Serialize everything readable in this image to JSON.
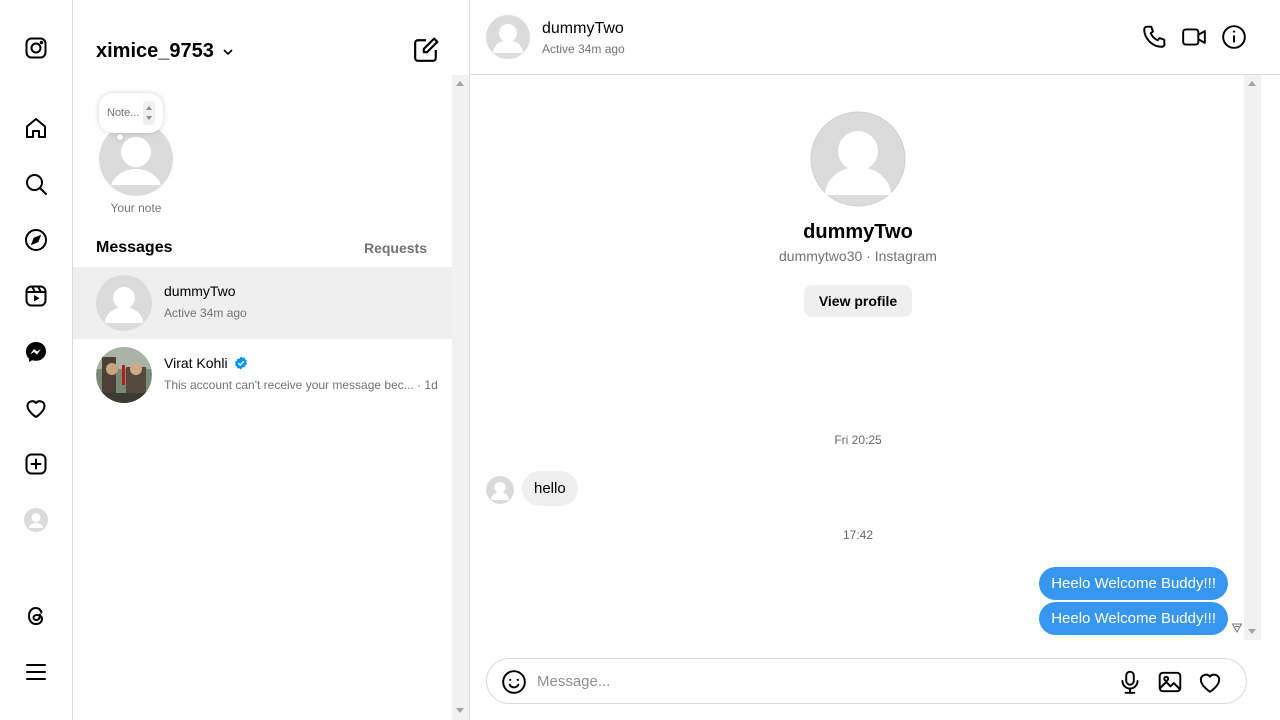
{
  "sidebar": {
    "icons": [
      "instagram-icon",
      "home-icon",
      "search-icon",
      "explore-icon",
      "reels-icon",
      "messenger-icon",
      "notifications-icon",
      "create-icon",
      "profile-avatar",
      "threads-icon",
      "menu-icon"
    ]
  },
  "list": {
    "account_name": "ximice_9753",
    "note_placeholder": "Note...",
    "note_label": "Your note",
    "messages_title": "Messages",
    "requests_label": "Requests",
    "conversations": [
      {
        "name": "dummyTwo",
        "preview": "Active 34m ago",
        "active": true,
        "verified": false
      },
      {
        "name": "Virat Kohli",
        "preview": "This account can't receive your message bec... · 1d",
        "active": false,
        "verified": true
      }
    ]
  },
  "chat": {
    "header": {
      "name": "dummyTwo",
      "status": "Active 34m ago"
    },
    "profile": {
      "name": "dummyTwo",
      "handle": "dummytwo30 · Instagram",
      "view_profile_label": "View profile"
    },
    "messages": [
      {
        "type": "time",
        "text": "Fri 20:25"
      },
      {
        "type": "incoming",
        "text": "hello"
      },
      {
        "type": "time",
        "text": "17:42"
      },
      {
        "type": "outgoing",
        "text": "Heelo Welcome Buddy!!!"
      },
      {
        "type": "outgoing",
        "text": "Heelo Welcome Buddy!!!"
      }
    ],
    "composer": {
      "placeholder": "Message..."
    }
  },
  "colors": {
    "accent": "#3797f0",
    "border": "#dbdbdb",
    "muted": "#737373",
    "active_row": "#efefef",
    "verified": "#0095f6"
  }
}
